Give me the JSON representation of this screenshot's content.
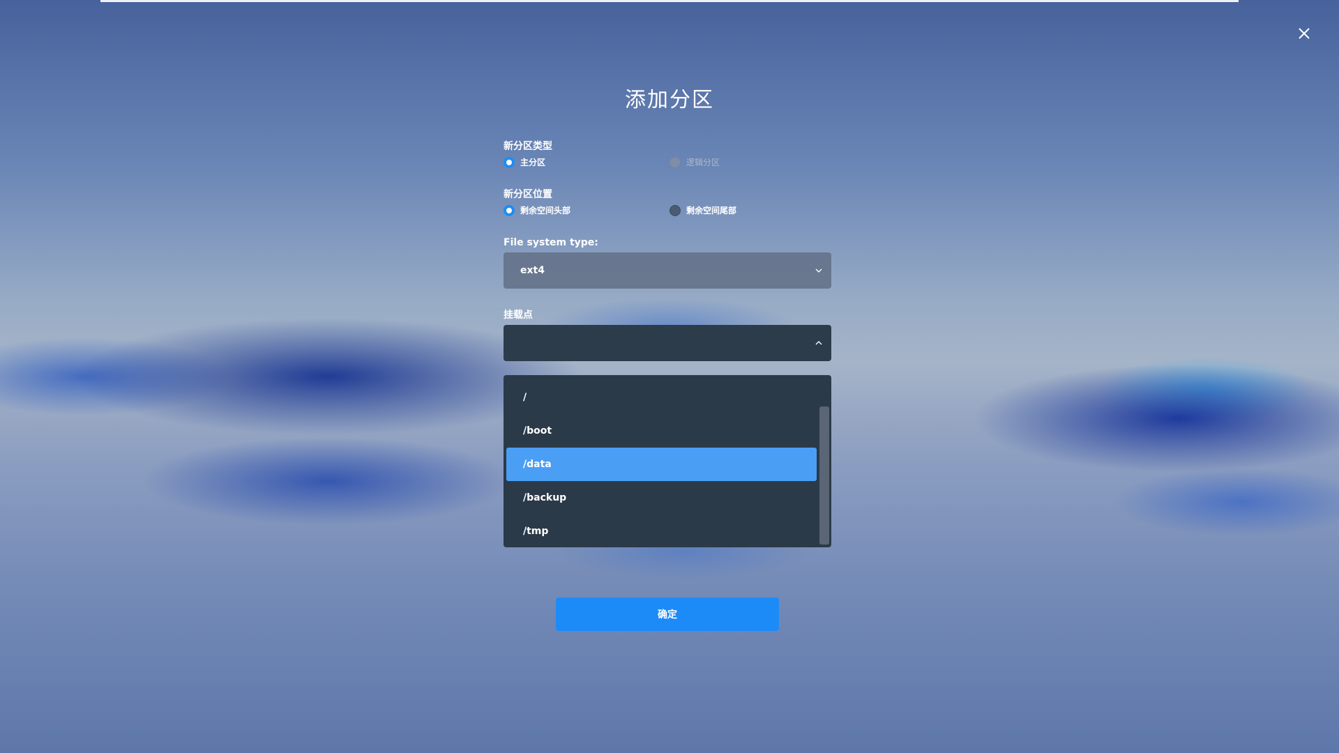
{
  "dialog": {
    "title": "添加分区",
    "close_icon": "close-icon"
  },
  "partition_type": {
    "label": "新分区类型",
    "options": [
      {
        "label": "主分区",
        "checked": true,
        "disabled": false
      },
      {
        "label": "逻辑分区",
        "checked": false,
        "disabled": true
      }
    ]
  },
  "partition_location": {
    "label": "新分区位置",
    "options": [
      {
        "label": "剩余空间头部",
        "checked": true,
        "disabled": false
      },
      {
        "label": "剩余空间尾部",
        "checked": false,
        "disabled": false
      }
    ]
  },
  "filesystem": {
    "label": "File system type:",
    "value": "ext4",
    "icon": "chevron-down-icon"
  },
  "mount_point": {
    "label": "挂载点",
    "value": "",
    "icon": "chevron-up-icon",
    "options": [
      {
        "label": "/",
        "selected": false
      },
      {
        "label": "/boot",
        "selected": false
      },
      {
        "label": "/data",
        "selected": true
      },
      {
        "label": "/backup",
        "selected": false
      },
      {
        "label": "/tmp",
        "selected": false
      }
    ]
  },
  "confirm_label": "确定",
  "colors": {
    "accent": "#1d8bf7",
    "selected_option": "#4a9ff5",
    "dropdown_bg": "#2b3a48"
  }
}
